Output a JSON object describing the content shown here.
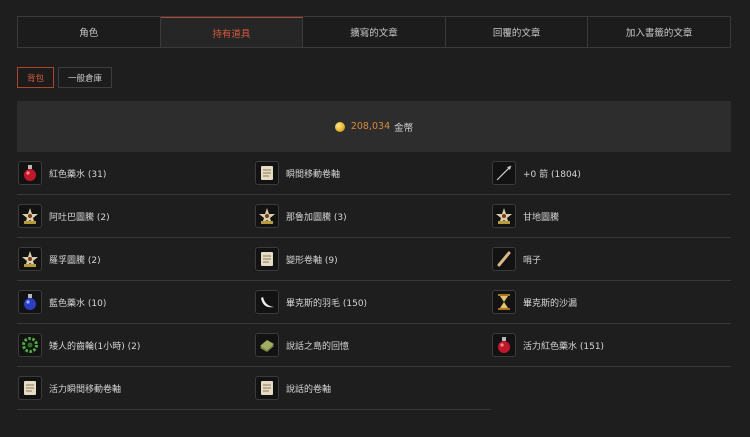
{
  "tabs": [
    {
      "label": "角色"
    },
    {
      "label": "持有道具"
    },
    {
      "label": "擴寫的文章"
    },
    {
      "label": "回覆的文章"
    },
    {
      "label": "加入書籤的文章"
    }
  ],
  "subtabs": [
    {
      "label": "背包"
    },
    {
      "label": "一般倉庫"
    }
  ],
  "gold": {
    "amount": "208,034",
    "unit": "金幣"
  },
  "colors": {
    "accent": "#d8593c",
    "gold_text": "#d88a3a"
  },
  "items": [
    {
      "label": "紅色藥水 (31)",
      "icon": "red-potion-icon"
    },
    {
      "label": "瞬間移動卷軸",
      "icon": "scroll-icon"
    },
    {
      "label": "+0 箭 (1804)",
      "icon": "arrow-icon"
    },
    {
      "label": "阿吐巴圖騰 (2)",
      "icon": "totem-icon"
    },
    {
      "label": "那魯加圖騰 (3)",
      "icon": "totem-icon"
    },
    {
      "label": "甘地圖騰",
      "icon": "totem-icon"
    },
    {
      "label": "羅孚圖騰 (2)",
      "icon": "totem-icon"
    },
    {
      "label": "變形卷軸 (9)",
      "icon": "scroll-icon"
    },
    {
      "label": "哨子",
      "icon": "whistle-icon"
    },
    {
      "label": "藍色藥水 (10)",
      "icon": "blue-potion-icon"
    },
    {
      "label": "畢克斯的羽毛 (150)",
      "icon": "feather-icon"
    },
    {
      "label": "畢克斯的沙漏",
      "icon": "hourglass-icon"
    },
    {
      "label": "矮人的齒輪(1小時) (2)",
      "icon": "gear-icon"
    },
    {
      "label": "說話之島的回憶",
      "icon": "book-icon"
    },
    {
      "label": "活力紅色藥水 (151)",
      "icon": "red-potion-icon"
    },
    {
      "label": "活力瞬間移動卷軸",
      "icon": "scroll-icon"
    },
    {
      "label": "說話的卷軸",
      "icon": "scroll-icon"
    }
  ]
}
